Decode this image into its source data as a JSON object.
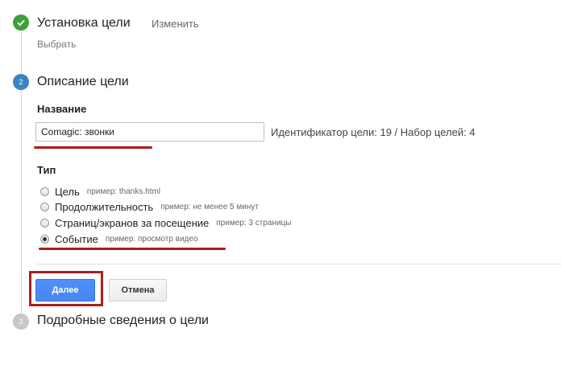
{
  "steps": [
    {
      "number": "✓",
      "title": "Установка цели",
      "action": "Изменить",
      "summary": "Выбрать"
    },
    {
      "number": "2",
      "title": "Описание цели"
    },
    {
      "number": "3",
      "title": "Подробные сведения о цели"
    }
  ],
  "form": {
    "name_label": "Название",
    "name_value": "Comagic: звонки",
    "identifier_text": "Идентификатор цели: 19 / Набор целей: 4",
    "type_label": "Тип",
    "type_options": [
      {
        "label": "Цель",
        "example": "пример: thanks.html",
        "checked": false
      },
      {
        "label": "Продолжительность",
        "example": "пример: не менее 5 минут",
        "checked": false
      },
      {
        "label": "Страниц/экранов за посещение",
        "example": "пример: 3 страницы",
        "checked": false
      },
      {
        "label": "Событие",
        "example": "пример: просмотр видео",
        "checked": true
      }
    ]
  },
  "buttons": {
    "next": "Далее",
    "cancel": "Отмена"
  },
  "colors": {
    "step_done": "#3aa13b",
    "step_active": "#3b84c4",
    "step_pending": "#c7c7c7",
    "primary_button": "#4d90fe",
    "annotation_red": "#b01818"
  }
}
